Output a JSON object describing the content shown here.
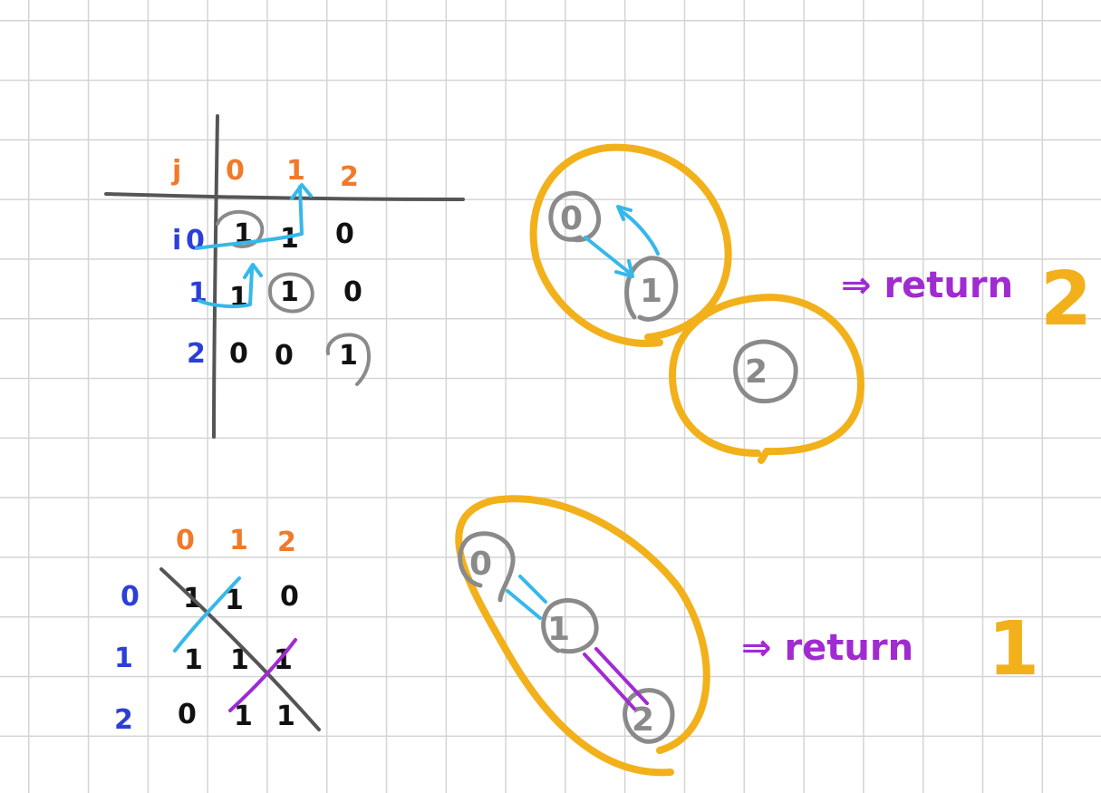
{
  "colors": {
    "grid": "#d4d4d4",
    "axis": "#555555",
    "index_orange": "#f07a2a",
    "index_blue": "#2b3fd8",
    "value_black": "#111111",
    "path_cyan": "#35b8ea",
    "node_gray": "#8a8a8a",
    "group_gold": "#f2b01a",
    "return_purple": "#a02bd0"
  },
  "top": {
    "matrix": {
      "col_label": "j",
      "row_label": "i",
      "col_indices": [
        "0",
        "1",
        "2"
      ],
      "row_indices": [
        "0",
        "1",
        "2"
      ],
      "rows": [
        [
          "1",
          "1",
          "0"
        ],
        [
          "1",
          "1",
          "0"
        ],
        [
          "0",
          "0",
          "1"
        ]
      ]
    },
    "nodes": [
      "0",
      "1",
      "2"
    ],
    "return_text": "⇒ return",
    "return_value": "2"
  },
  "bottom": {
    "matrix": {
      "col_indices": [
        "0",
        "1",
        "2"
      ],
      "row_indices": [
        "0",
        "1",
        "2"
      ],
      "rows": [
        [
          "1",
          "1",
          "0"
        ],
        [
          "1",
          "1",
          "1"
        ],
        [
          "0",
          "1",
          "1"
        ]
      ]
    },
    "nodes": [
      "0",
      "1",
      "2"
    ],
    "return_text": "⇒ return",
    "return_value": "1"
  }
}
